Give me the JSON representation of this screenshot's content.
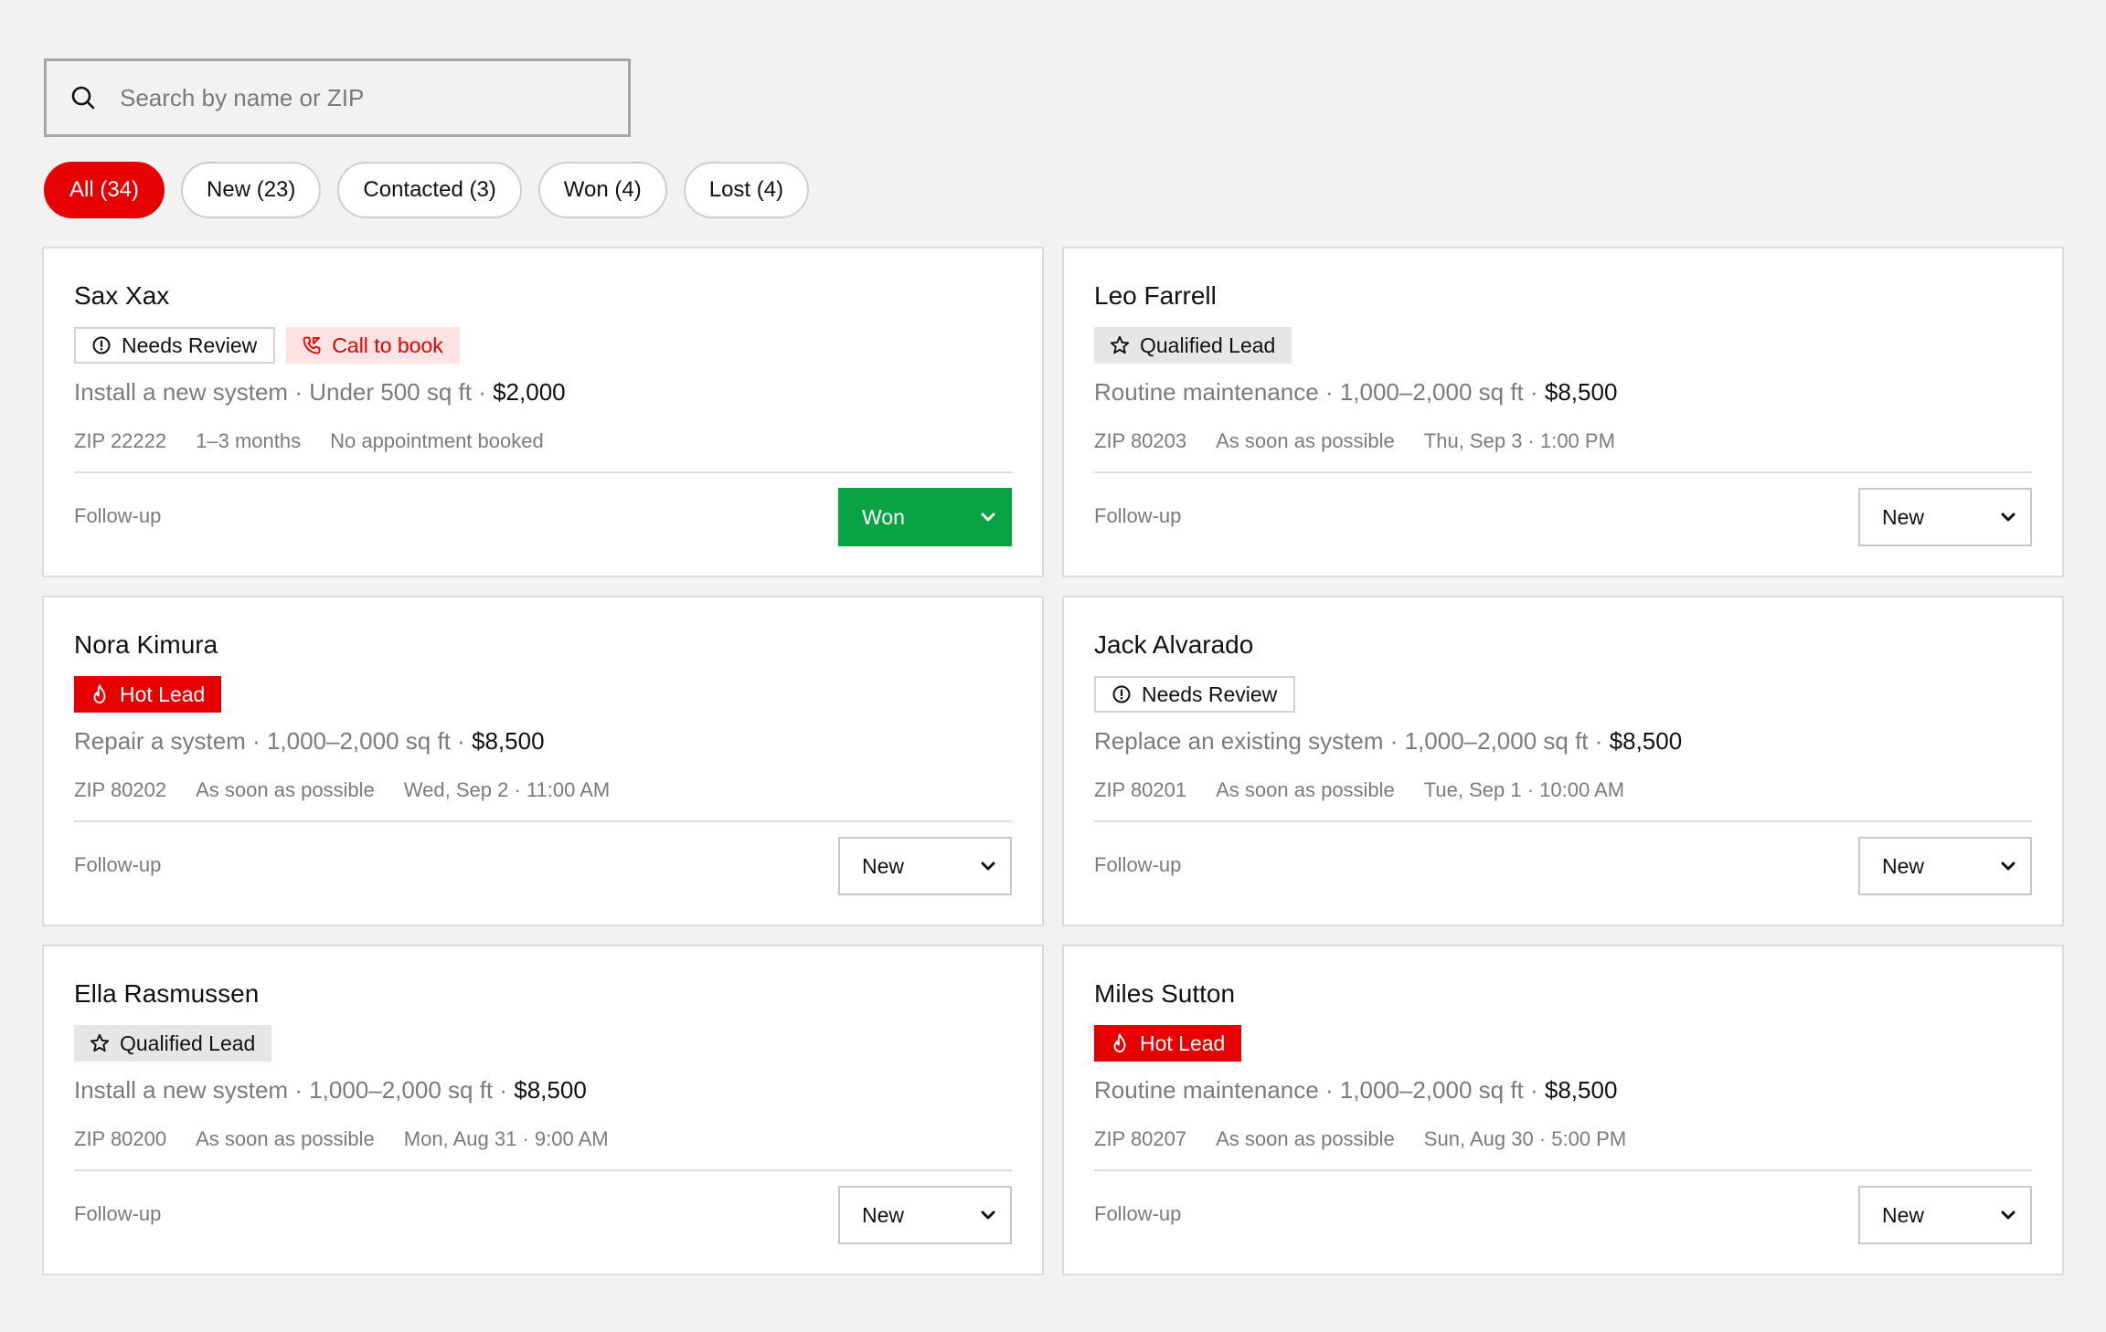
{
  "search": {
    "placeholder": "Search by name or ZIP",
    "icon": "search-icon"
  },
  "filters": [
    {
      "label": "All (34)",
      "active": true
    },
    {
      "label": "New (23)",
      "active": false
    },
    {
      "label": "Contacted (3)",
      "active": false
    },
    {
      "label": "Won (4)",
      "active": false
    },
    {
      "label": "Lost (4)",
      "active": false
    }
  ],
  "colors": {
    "accent_red": "#e60000",
    "won_green": "#0aa344",
    "call_bg": "#fde3e3",
    "qualified_bg": "#e6e6e6",
    "page_bg": "#f2f2f2"
  },
  "leads": [
    {
      "name": "Sax Xax",
      "badges": [
        {
          "type": "review",
          "label": "Needs Review",
          "icon": "alert-circle-icon"
        },
        {
          "type": "call",
          "label": "Call to book",
          "icon": "phone-icon"
        }
      ],
      "job": "Install a new system",
      "size": "Under 500 sq ft",
      "price": "$2,000",
      "zip": "ZIP 22222",
      "timeline": "1–3 months",
      "appointment": "No appointment booked",
      "followup_label": "Follow-up",
      "status": "Won"
    },
    {
      "name": "Leo Farrell",
      "badges": [
        {
          "type": "qualified",
          "label": "Qualified Lead",
          "icon": "star-icon"
        }
      ],
      "job": "Routine maintenance",
      "size": "1,000–2,000 sq ft",
      "price": "$8,500",
      "zip": "ZIP 80203",
      "timeline": "As soon as possible",
      "appointment": "Thu, Sep 3 · 1:00 PM",
      "followup_label": "Follow-up",
      "status": "New"
    },
    {
      "name": "Nora Kimura",
      "badges": [
        {
          "type": "hot",
          "label": "Hot Lead",
          "icon": "flame-icon"
        }
      ],
      "job": "Repair a system",
      "size": "1,000–2,000 sq ft",
      "price": "$8,500",
      "zip": "ZIP 80202",
      "timeline": "As soon as possible",
      "appointment": "Wed, Sep 2 · 11:00 AM",
      "followup_label": "Follow-up",
      "status": "New"
    },
    {
      "name": "Jack Alvarado",
      "badges": [
        {
          "type": "review",
          "label": "Needs Review",
          "icon": "alert-circle-icon"
        }
      ],
      "job": "Replace an existing system",
      "size": "1,000–2,000 sq ft",
      "price": "$8,500",
      "zip": "ZIP 80201",
      "timeline": "As soon as possible",
      "appointment": "Tue, Sep 1 · 10:00 AM",
      "followup_label": "Follow-up",
      "status": "New"
    },
    {
      "name": "Ella Rasmussen",
      "badges": [
        {
          "type": "qualified",
          "label": "Qualified Lead",
          "icon": "star-icon"
        }
      ],
      "job": "Install a new system",
      "size": "1,000–2,000 sq ft",
      "price": "$8,500",
      "zip": "ZIP 80200",
      "timeline": "As soon as possible",
      "appointment": "Mon, Aug 31 · 9:00 AM",
      "followup_label": "Follow-up",
      "status": "New"
    },
    {
      "name": "Miles Sutton",
      "badges": [
        {
          "type": "hot",
          "label": "Hot Lead",
          "icon": "flame-icon"
        }
      ],
      "job": "Routine maintenance",
      "size": "1,000–2,000 sq ft",
      "price": "$8,500",
      "zip": "ZIP 80207",
      "timeline": "As soon as possible",
      "appointment": "Sun, Aug 30 · 5:00 PM",
      "followup_label": "Follow-up",
      "status": "New"
    }
  ]
}
